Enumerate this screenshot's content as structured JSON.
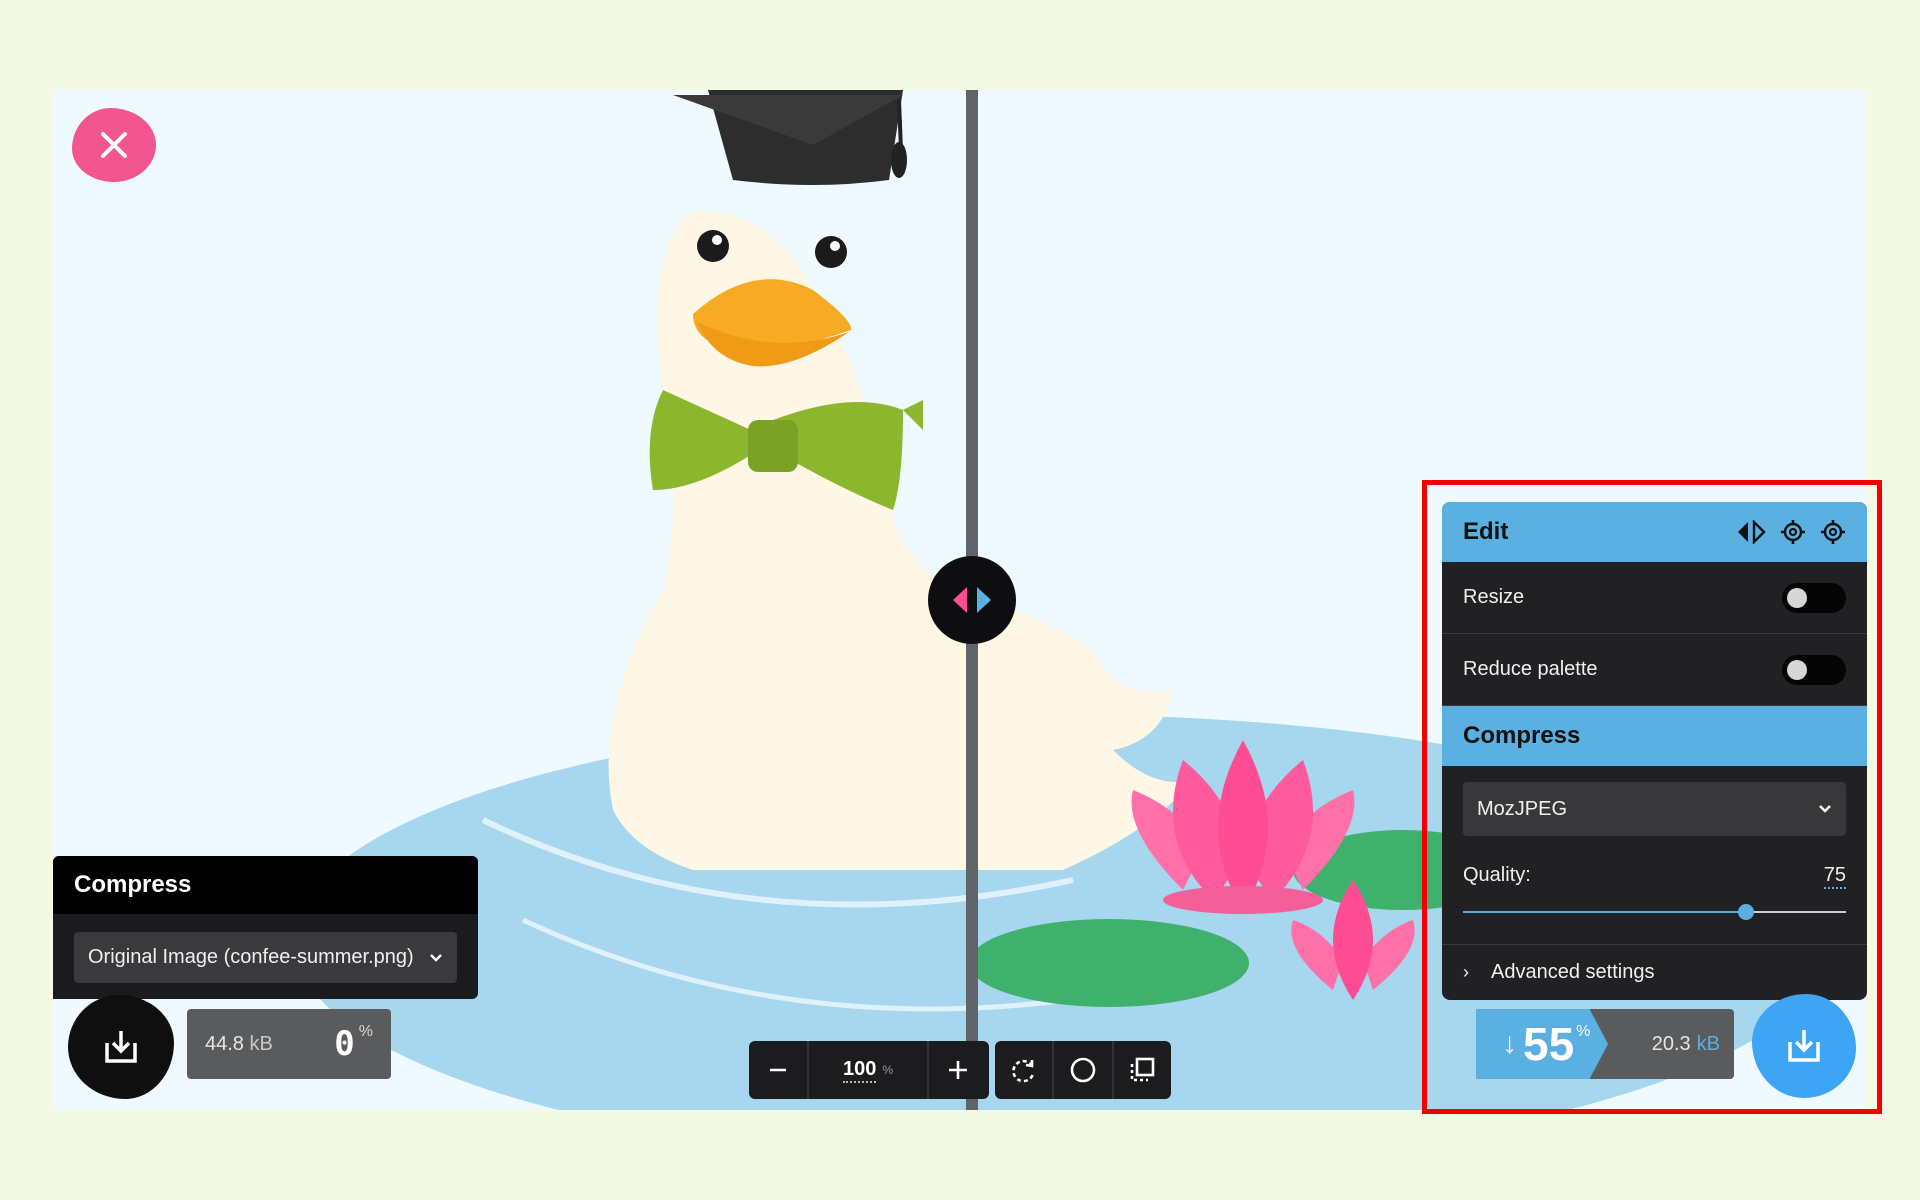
{
  "left_panel": {
    "title": "Compress",
    "source_select": "Original Image (confee-summer.png)"
  },
  "left_stats": {
    "size_value": "44.8",
    "size_unit": "kB",
    "percent_value": "0",
    "percent_sign": "%"
  },
  "zoom": {
    "value": "100",
    "unit": "%"
  },
  "right_panel": {
    "edit_title": "Edit",
    "resize_label": "Resize",
    "resize_enabled": false,
    "reduce_palette_label": "Reduce palette",
    "reduce_palette_enabled": false,
    "compress_title": "Compress",
    "codec": "MozJPEG",
    "quality_label": "Quality:",
    "quality_value": "75",
    "quality_fraction": 0.74,
    "advanced_label": "Advanced settings"
  },
  "right_stats": {
    "arrow": "↓",
    "percent_value": "55",
    "percent_sign": "%",
    "size_value": "20.3",
    "size_unit": "kB"
  },
  "colors": {
    "accent_blue": "#5ab0e0",
    "close_pink": "#f3568f",
    "download_blue": "#3ea4f4"
  },
  "icons": {
    "close": "close-icon",
    "download": "download-icon",
    "split": "split-view-icon",
    "rotate": "rotate-icon",
    "background": "circle-icon",
    "crop": "crop-icon",
    "import_settings": "gear-upload-icon",
    "export_settings": "gear-download-icon"
  }
}
